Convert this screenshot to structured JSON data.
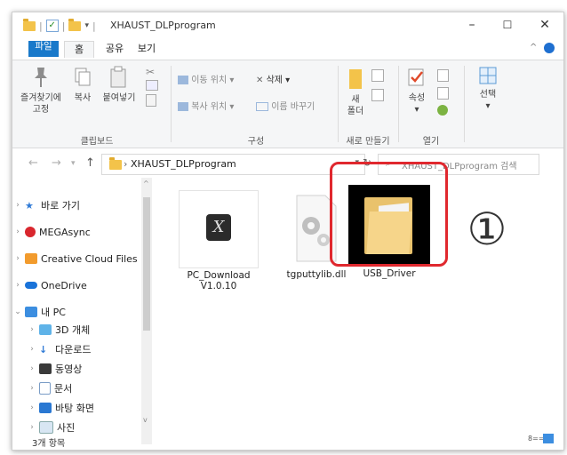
{
  "window": {
    "title": "XHAUST_DLPprogram",
    "qa_separator": "|",
    "qa_dropdown": "▾",
    "controls": {
      "minimize": "–",
      "maximize": "☐",
      "close": "✕"
    }
  },
  "tabs": {
    "file": "파일",
    "home": "홈",
    "share": "공유",
    "view": "보기"
  },
  "ribbon": {
    "clipboard": {
      "pin_label_1": "즐겨찾기에",
      "pin_label_2": "고정",
      "copy": "복사",
      "paste": "붙여넣기",
      "group": "클립보드"
    },
    "organize": {
      "move_to": "이동 위치",
      "copy_to": "복사 위치",
      "delete": "삭제",
      "rename": "이름 바꾸기",
      "group": "구성"
    },
    "new": {
      "new_folder_1": "새",
      "new_folder_2": "폴더",
      "group": "새로 만들기"
    },
    "open": {
      "properties": "속성",
      "group": "열기"
    },
    "select": {
      "label": "선택"
    },
    "dropdown_arrow": "▾"
  },
  "address": {
    "path": "XHAUST_DLPprogram",
    "search_placeholder": "XHAUST_DLPprogram 검색"
  },
  "nav": {
    "quick_access": "바로 가기",
    "mega": "MEGAsync",
    "creative": "Creative Cloud Files",
    "onedrive": "OneDrive",
    "this_pc": "내 PC",
    "objects3d": "3D 개체",
    "downloads": "다운로드",
    "videos": "동영상",
    "documents": "문서",
    "desktop": "바탕 화면",
    "pictures": "사진"
  },
  "files": [
    {
      "name_1": "PC_Download",
      "name_2": "V1.0.10"
    },
    {
      "name_1": "tgputtylib.dll",
      "name_2": ""
    },
    {
      "name_1": "USB_Driver",
      "name_2": ""
    }
  ],
  "status": {
    "count": "3개 항목"
  },
  "annotation": {
    "number": "①"
  },
  "colors": {
    "accent": "#1979ca",
    "highlight": "#e0282e",
    "folder": "#f3c34a"
  }
}
